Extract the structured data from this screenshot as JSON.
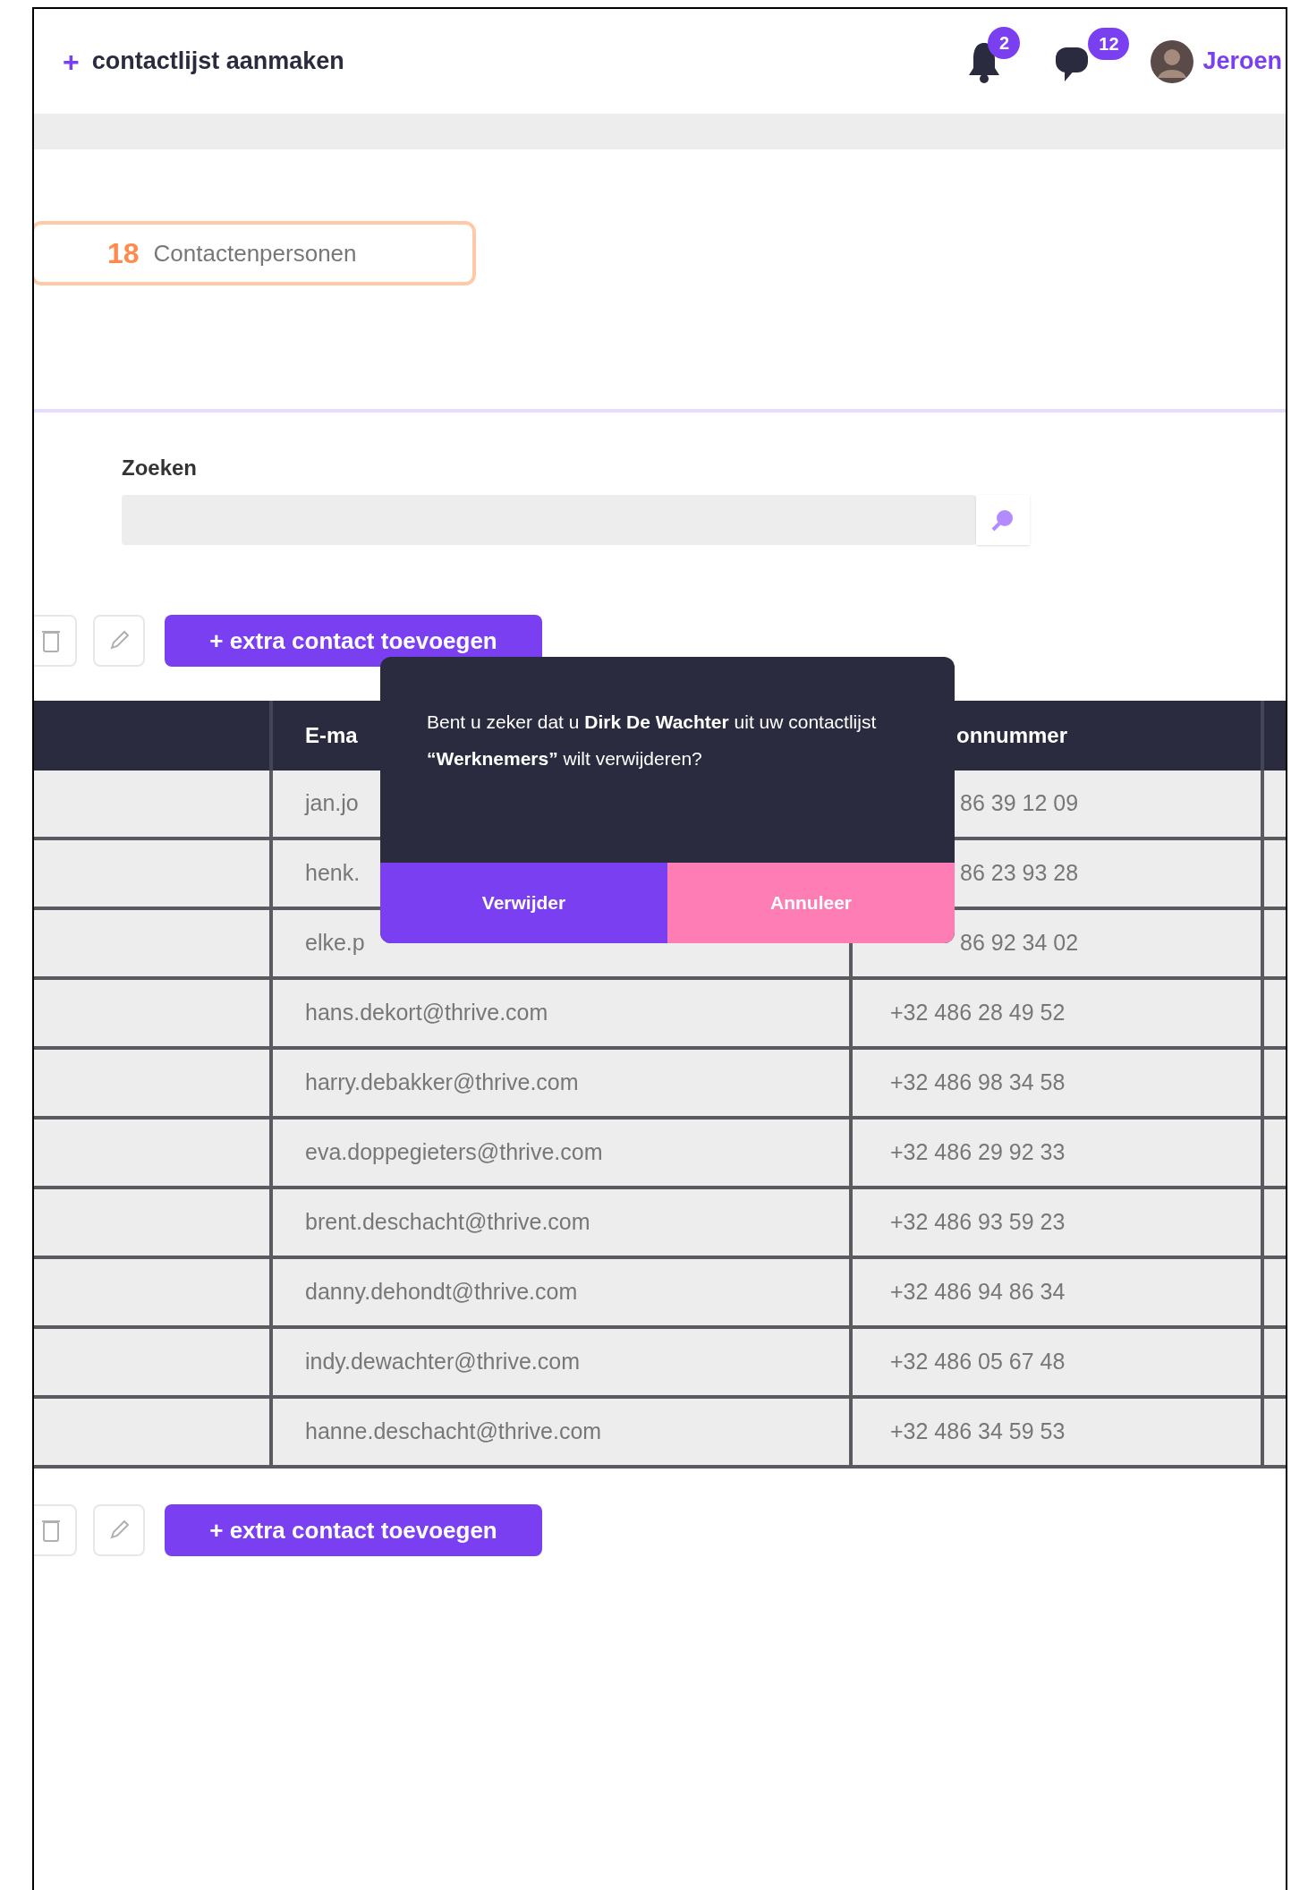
{
  "header": {
    "action": "+",
    "title": "contactlijst aanmaken",
    "notifications": "2",
    "messages": "12",
    "user": "Jeroen"
  },
  "badge": {
    "count": "18",
    "label": "Contactenpersonen"
  },
  "search": {
    "label": "Zoeken"
  },
  "add_button": "+ extra contact toevoegen",
  "table": {
    "columns": [
      "E-ma",
      "onnummer"
    ],
    "rows": [
      {
        "email": "jan.jo",
        "phone": "86 39 12 09",
        "clipped": true
      },
      {
        "email": "henk.",
        "phone": "86 23 93 28",
        "clipped": true
      },
      {
        "email": "elke.p",
        "phone": "86 92 34 02",
        "clipped": true
      },
      {
        "email": "hans.dekort@thrive.com",
        "phone": "+32 486 28 49 52",
        "clipped": false
      },
      {
        "email": "harry.debakker@thrive.com",
        "phone": "+32 486 98 34 58",
        "clipped": false
      },
      {
        "email": "eva.doppegieters@thrive.com",
        "phone": "+32 486 29 92 33",
        "clipped": false
      },
      {
        "email": "brent.deschacht@thrive.com",
        "phone": "+32 486 93 59 23",
        "clipped": false
      },
      {
        "email": "danny.dehondt@thrive.com",
        "phone": "+32 486 94 86 34",
        "clipped": false
      },
      {
        "email": "indy.dewachter@thrive.com",
        "phone": "+32 486 05 67 48",
        "clipped": false
      },
      {
        "email": "hanne.deschacht@thrive.com",
        "phone": "+32 486 34 59 53",
        "clipped": false
      }
    ]
  },
  "bottom_add_button": "+ extra contact toevoegen",
  "dialog": {
    "message": "Bent u zeker dat u **Dirk De Wachter** uit uw contactlijst **“Werknemers”** wilt verwijderen?",
    "confirm": "Verwijder",
    "cancel": "Annuleer"
  }
}
